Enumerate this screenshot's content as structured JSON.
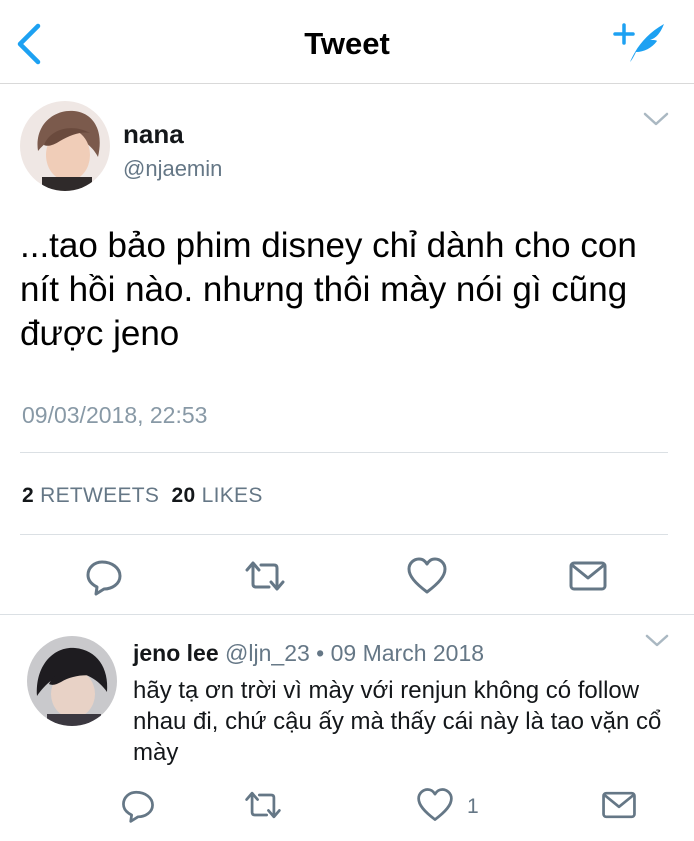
{
  "nav": {
    "title": "Tweet",
    "back_icon": "chevron-left-icon",
    "compose_icon": "compose-tweet-icon",
    "accent_color": "#1da1f2"
  },
  "tweet": {
    "author": {
      "name": "nana",
      "handle": "@njaemin"
    },
    "text": "...tao bảo phim disney chỉ dành cho con nít hồi nào. nhưng thôi mày nói gì cũng được jeno",
    "timestamp": "09/03/2018, 22:53",
    "stats": {
      "retweets_count": "2",
      "retweets_label": "RETWEETS",
      "likes_count": "20",
      "likes_label": "LIKES"
    },
    "actions": [
      "reply-icon",
      "retweet-icon",
      "like-icon",
      "message-icon"
    ]
  },
  "reply": {
    "author": {
      "name": "jeno lee",
      "handle": "@ljn_23"
    },
    "separator": "•",
    "date": "09 March 2018",
    "text": "hãy tạ ơn trời vì mày với renjun không có follow nhau đi, chứ cậu ấy mà thấy cái này là tao vặn cổ mày",
    "like_count": "1"
  }
}
